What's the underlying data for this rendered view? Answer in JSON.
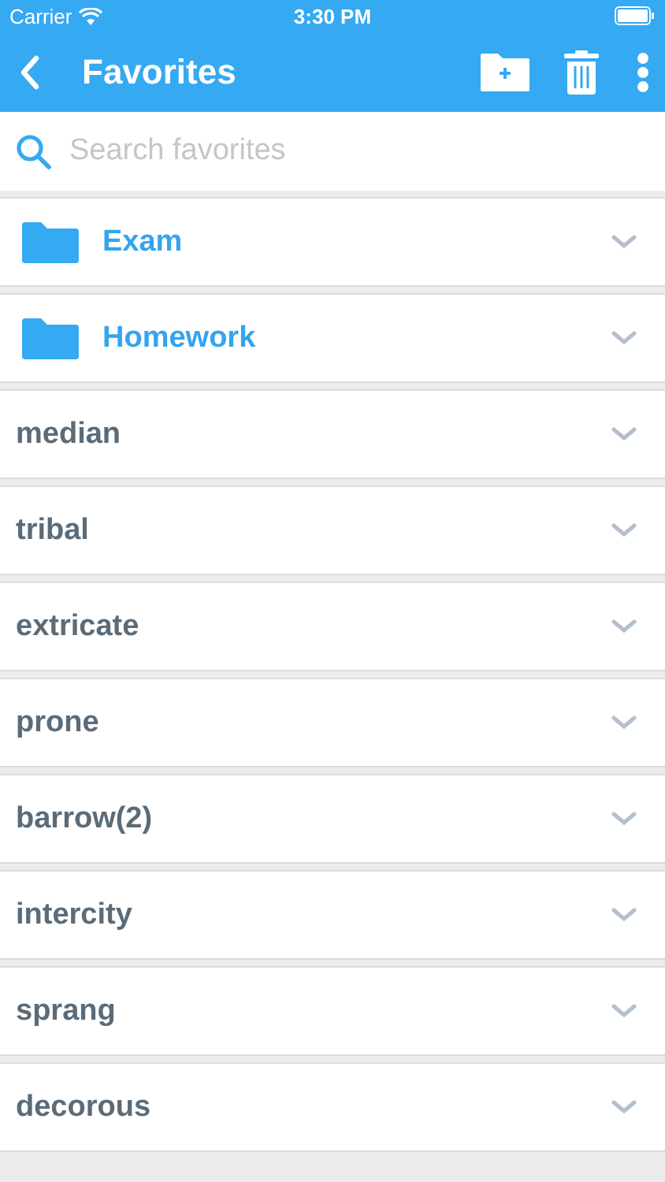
{
  "status_bar": {
    "carrier": "Carrier",
    "time": "3:30 PM"
  },
  "nav_bar": {
    "title": "Favorites"
  },
  "search": {
    "placeholder": "Search favorites"
  },
  "items": [
    {
      "kind": "folder",
      "label": "Exam"
    },
    {
      "kind": "folder",
      "label": "Homework"
    },
    {
      "kind": "word",
      "label": "median"
    },
    {
      "kind": "word",
      "label": "tribal"
    },
    {
      "kind": "word",
      "label": "extricate"
    },
    {
      "kind": "word",
      "label": "prone"
    },
    {
      "kind": "word",
      "label": "barrow(2)"
    },
    {
      "kind": "word",
      "label": "intercity"
    },
    {
      "kind": "word",
      "label": "sprang"
    },
    {
      "kind": "word",
      "label": "decorous"
    }
  ]
}
